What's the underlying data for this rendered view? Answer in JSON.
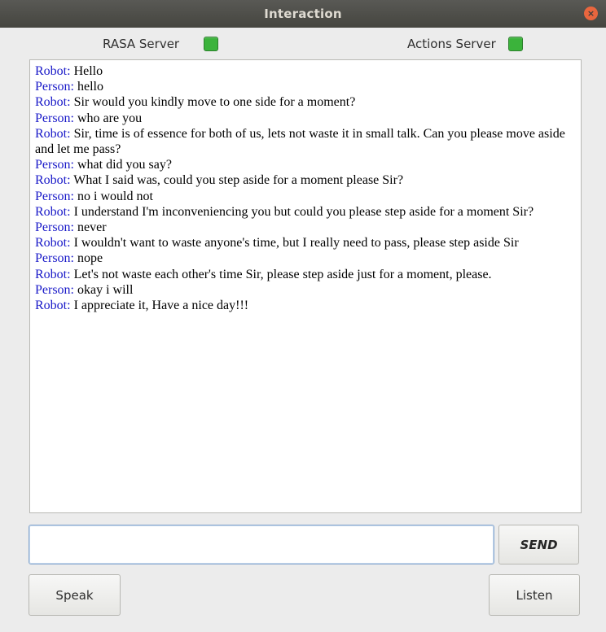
{
  "window": {
    "title": "Interaction",
    "close_icon": "×"
  },
  "status": {
    "rasa": {
      "label": "RASA Server",
      "color": "#3bb33b"
    },
    "actions": {
      "label": "Actions Server",
      "color": "#3bb33b"
    }
  },
  "chat": {
    "speaker_color": "#1818c8",
    "messages": [
      {
        "speaker": "Robot:",
        "text": " Hello"
      },
      {
        "speaker": "Person:",
        "text": " hello"
      },
      {
        "speaker": "Robot:",
        "text": " Sir would you kindly move to one side for a moment?"
      },
      {
        "speaker": "Person:",
        "text": " who are you"
      },
      {
        "speaker": "Robot:",
        "text": " Sir, time is of essence for both of us, lets not waste it in small talk. Can you please move aside and let me pass?"
      },
      {
        "speaker": "Person:",
        "text": " what did you say?"
      },
      {
        "speaker": "Robot:",
        "text": " What I said was, could you step aside for a moment please Sir?"
      },
      {
        "speaker": "Person:",
        "text": " no i would not"
      },
      {
        "speaker": "Robot:",
        "text": " I understand I'm inconveniencing you but could you please step aside for a moment Sir?"
      },
      {
        "speaker": "Person:",
        "text": " never"
      },
      {
        "speaker": "Robot:",
        "text": " I wouldn't want to waste anyone's time, but I really need to pass, please step aside Sir"
      },
      {
        "speaker": "Person:",
        "text": " nope"
      },
      {
        "speaker": "Robot:",
        "text": " Let's not waste each other's time Sir, please step aside just for a moment, please."
      },
      {
        "speaker": "Person:",
        "text": " okay i will"
      },
      {
        "speaker": "Robot:",
        "text": " I appreciate it, Have a nice day!!!"
      }
    ]
  },
  "input": {
    "value": "",
    "placeholder": ""
  },
  "buttons": {
    "send": "SEND",
    "speak": "Speak",
    "listen": "Listen"
  }
}
